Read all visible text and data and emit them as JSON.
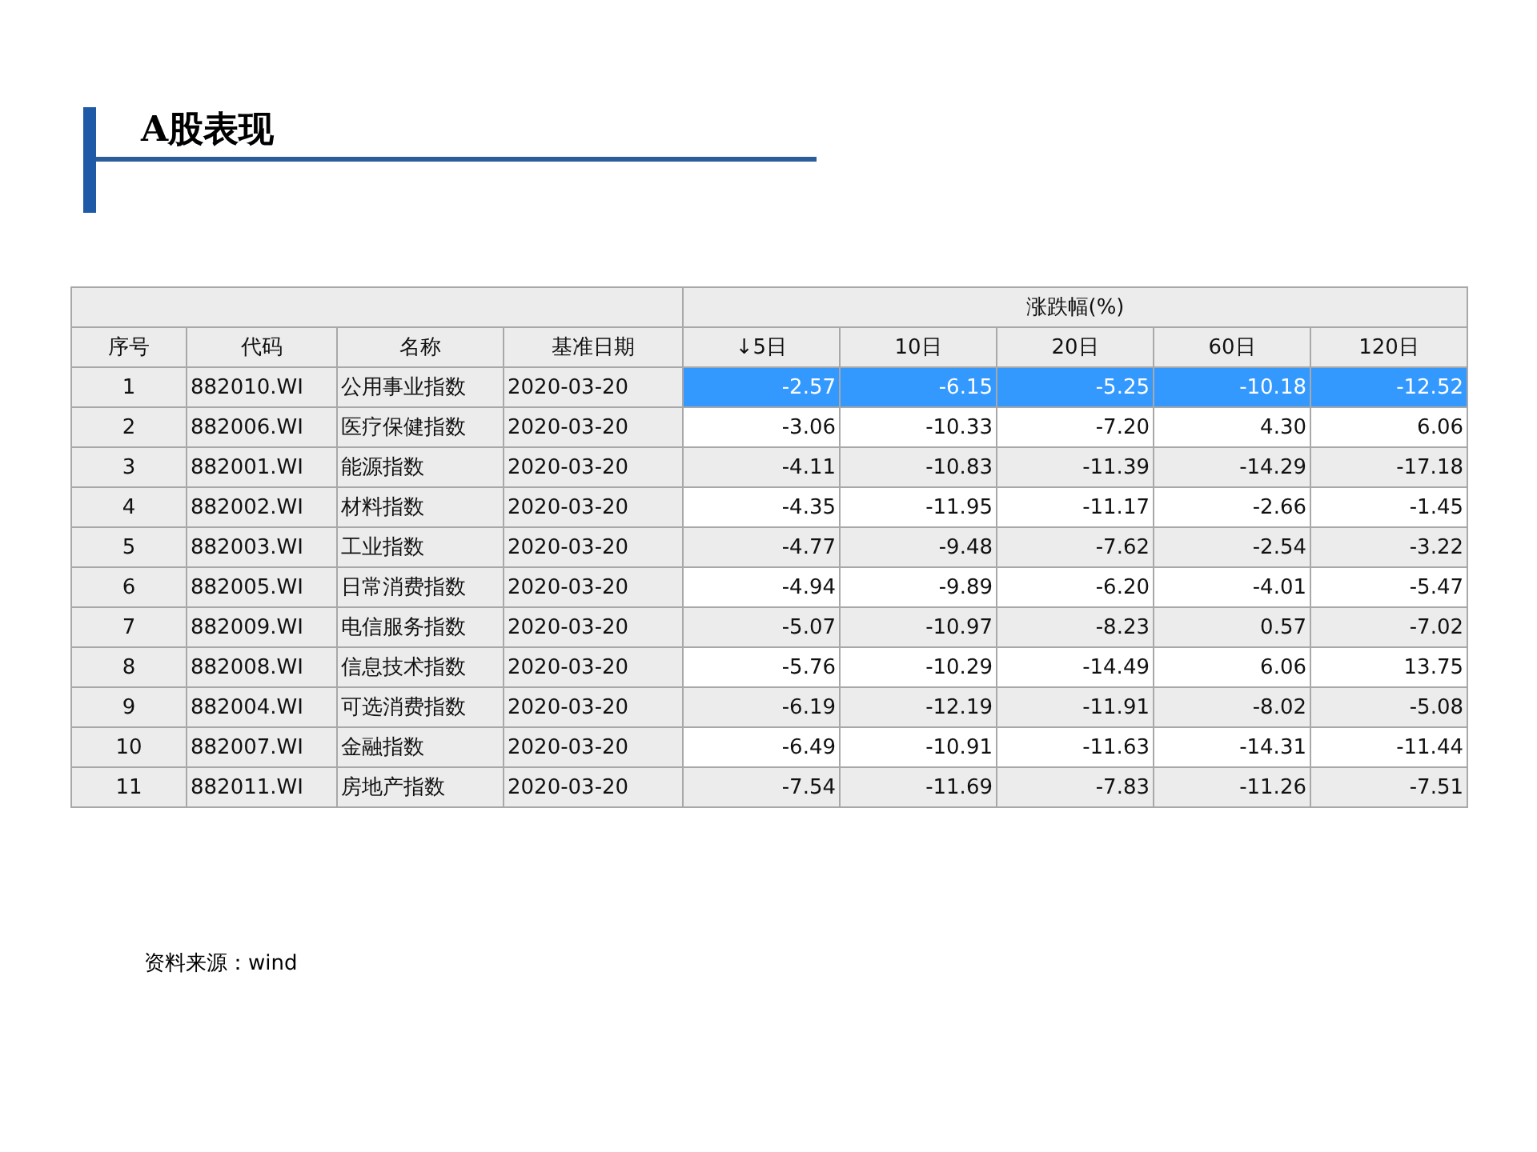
{
  "title": "A股表现",
  "table": {
    "group_header": "涨跌幅(%)",
    "columns": [
      "序号",
      "代码",
      "名称",
      "基准日期",
      "↓5日",
      "10日",
      "20日",
      "60日",
      "120日"
    ],
    "rows": [
      {
        "selected": true,
        "cells": [
          "1",
          "882010.WI",
          "公用事业指数",
          "2020-03-20",
          "-2.57",
          "-6.15",
          "-5.25",
          "-10.18",
          "-12.52"
        ]
      },
      {
        "selected": false,
        "cells": [
          "2",
          "882006.WI",
          "医疗保健指数",
          "2020-03-20",
          "-3.06",
          "-10.33",
          "-7.20",
          "4.30",
          "6.06"
        ]
      },
      {
        "selected": false,
        "cells": [
          "3",
          "882001.WI",
          "能源指数",
          "2020-03-20",
          "-4.11",
          "-10.83",
          "-11.39",
          "-14.29",
          "-17.18"
        ]
      },
      {
        "selected": false,
        "cells": [
          "4",
          "882002.WI",
          "材料指数",
          "2020-03-20",
          "-4.35",
          "-11.95",
          "-11.17",
          "-2.66",
          "-1.45"
        ]
      },
      {
        "selected": false,
        "cells": [
          "5",
          "882003.WI",
          "工业指数",
          "2020-03-20",
          "-4.77",
          "-9.48",
          "-7.62",
          "-2.54",
          "-3.22"
        ]
      },
      {
        "selected": false,
        "cells": [
          "6",
          "882005.WI",
          "日常消费指数",
          "2020-03-20",
          "-4.94",
          "-9.89",
          "-6.20",
          "-4.01",
          "-5.47"
        ]
      },
      {
        "selected": false,
        "cells": [
          "7",
          "882009.WI",
          "电信服务指数",
          "2020-03-20",
          "-5.07",
          "-10.97",
          "-8.23",
          "0.57",
          "-7.02"
        ]
      },
      {
        "selected": false,
        "cells": [
          "8",
          "882008.WI",
          "信息技术指数",
          "2020-03-20",
          "-5.76",
          "-10.29",
          "-14.49",
          "6.06",
          "13.75"
        ]
      },
      {
        "selected": false,
        "cells": [
          "9",
          "882004.WI",
          "可选消费指数",
          "2020-03-20",
          "-6.19",
          "-12.19",
          "-11.91",
          "-8.02",
          "-5.08"
        ]
      },
      {
        "selected": false,
        "cells": [
          "10",
          "882007.WI",
          "金融指数",
          "2020-03-20",
          "-6.49",
          "-10.91",
          "-11.63",
          "-14.31",
          "-11.44"
        ]
      },
      {
        "selected": false,
        "cells": [
          "11",
          "882011.WI",
          "房地产指数",
          "2020-03-20",
          "-7.54",
          "-11.69",
          "-7.83",
          "-11.26",
          "-7.51"
        ]
      }
    ]
  },
  "source": "资料来源：wind"
}
